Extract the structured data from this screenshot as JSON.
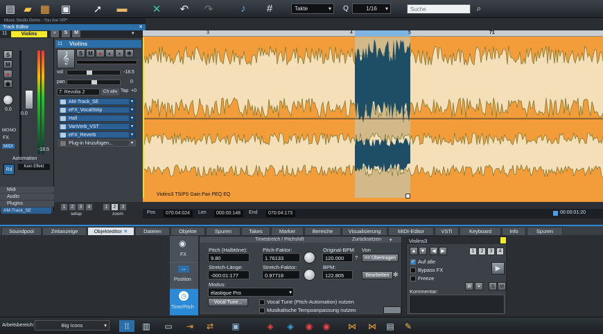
{
  "window": {
    "title": "Music Studio Demo - You Are VIP*"
  },
  "toolbar": {
    "snap_label": "Takte",
    "quantize_value": "1/16",
    "search_placeholder": "Suche"
  },
  "track_editor": {
    "title": "Track Editor",
    "track_number": "11",
    "track_name": "Violins",
    "left": {
      "mute": "M",
      "solo": "S",
      "mono": "MONO",
      "fx": "FX",
      "midi": "MIDI",
      "volume_value": "0.0",
      "level_value": "-18.5",
      "automation_label": "Automation",
      "read_btn": "Rd",
      "automation_mode": "Kein Effekt",
      "sections": [
        "Midi",
        "Audio",
        "Plugins"
      ],
      "plugin_select": "AM-Track_SE"
    },
    "track": {
      "number": "11",
      "name": "Violins",
      "vol_label": "vol",
      "vol_value": "-18.5",
      "pan_label": "pan",
      "pan_value": "0",
      "input": "7: Revolta 2",
      "ch_label": "Ch alle",
      "tap_label": "Tap",
      "tap_value": "+0",
      "plugins": [
        "AM-Track_SE",
        "eFX_VocalStrip",
        "Hall",
        "VariVerb_VST",
        "eFX_Reverb",
        "Plug-in hinzufügen..."
      ]
    },
    "footer": {
      "setup_label": "setup",
      "zoom_label": "zoom",
      "setup_nums": [
        "1",
        "2",
        "3",
        "4"
      ],
      "zoom_nums": [
        "1",
        "2",
        "3"
      ]
    }
  },
  "arrange": {
    "ruler_marks": [
      "3",
      "4",
      "5",
      "71"
    ],
    "clip_label": "Violins3  TS/PS Gain Pan PEQ EQ"
  },
  "status": {
    "pos_label": "Pos",
    "pos_value": "070:04:024",
    "len_label": "Len",
    "len_value": "000:00:148",
    "end_label": "End",
    "end_value": "070:04:173",
    "time_value": "00:00:01:20"
  },
  "tabs": [
    "Soundpool",
    "Zeitanzeige",
    "Objekteditor",
    "Dateien",
    "Objekte",
    "Spuren",
    "Takes",
    "Marker",
    "Bereiche",
    "Visualisierung",
    "MIDI-Editor",
    "VSTi",
    "Keyboard",
    "Info",
    "Spuren"
  ],
  "object_editor": {
    "side": {
      "fx": "FX",
      "position": "Position",
      "time_pitch": "Time/Pitch"
    },
    "title": "Timestretch / Pitchshift",
    "reset": "Zurücksetzen",
    "pitch_label": "Pitch (Halbtöne):",
    "pitch_value": "9.80",
    "pitch_factor_label": "Pitch-Faktor:",
    "pitch_factor_value": "1.76133",
    "orig_bpm_label": "Original-BPM:",
    "orig_bpm_value": "120.000",
    "loop_label": "Von Loop/Bereich",
    "transfer_btn": "<< Übertragen",
    "stretch_len_label": "Stretch-Länge:",
    "stretch_len_value": "-000:01:177",
    "stretch_factor_label": "Stretch-Faktor:",
    "stretch_factor_value": "0.97716",
    "bpm_label": "BPM:",
    "bpm_value": "122.805",
    "edit_btn": "Bearbeiten",
    "mode_label": "Modus:",
    "mode_value": "élastique Pro",
    "vocal_tune_btn": "Vocal Tune...",
    "vocal_tune_chk": "Vocal Tune (Pitch-Automation) nutzen",
    "tempo_chk": "Musikalische Tempoanpassung nutzen"
  },
  "instance": {
    "name": "Violins3",
    "auf_alle": "Auf alle",
    "bypass": "Bypass FX",
    "freeze": "Freeze",
    "nums": [
      "1",
      "2",
      "3",
      "4"
    ],
    "comment_label": "Kommentar:",
    "solo": "S",
    "mute": "M"
  },
  "bottom": {
    "workspace_label": "Arbeitsbereich:",
    "workspace_value": "Big Icons"
  },
  "colors": {
    "accent": "#2b8ad8",
    "clip": "#f29c3a",
    "clip_light": "#f5dfb9",
    "wave": "#7f7a34",
    "selection": "#1c4f6e"
  }
}
